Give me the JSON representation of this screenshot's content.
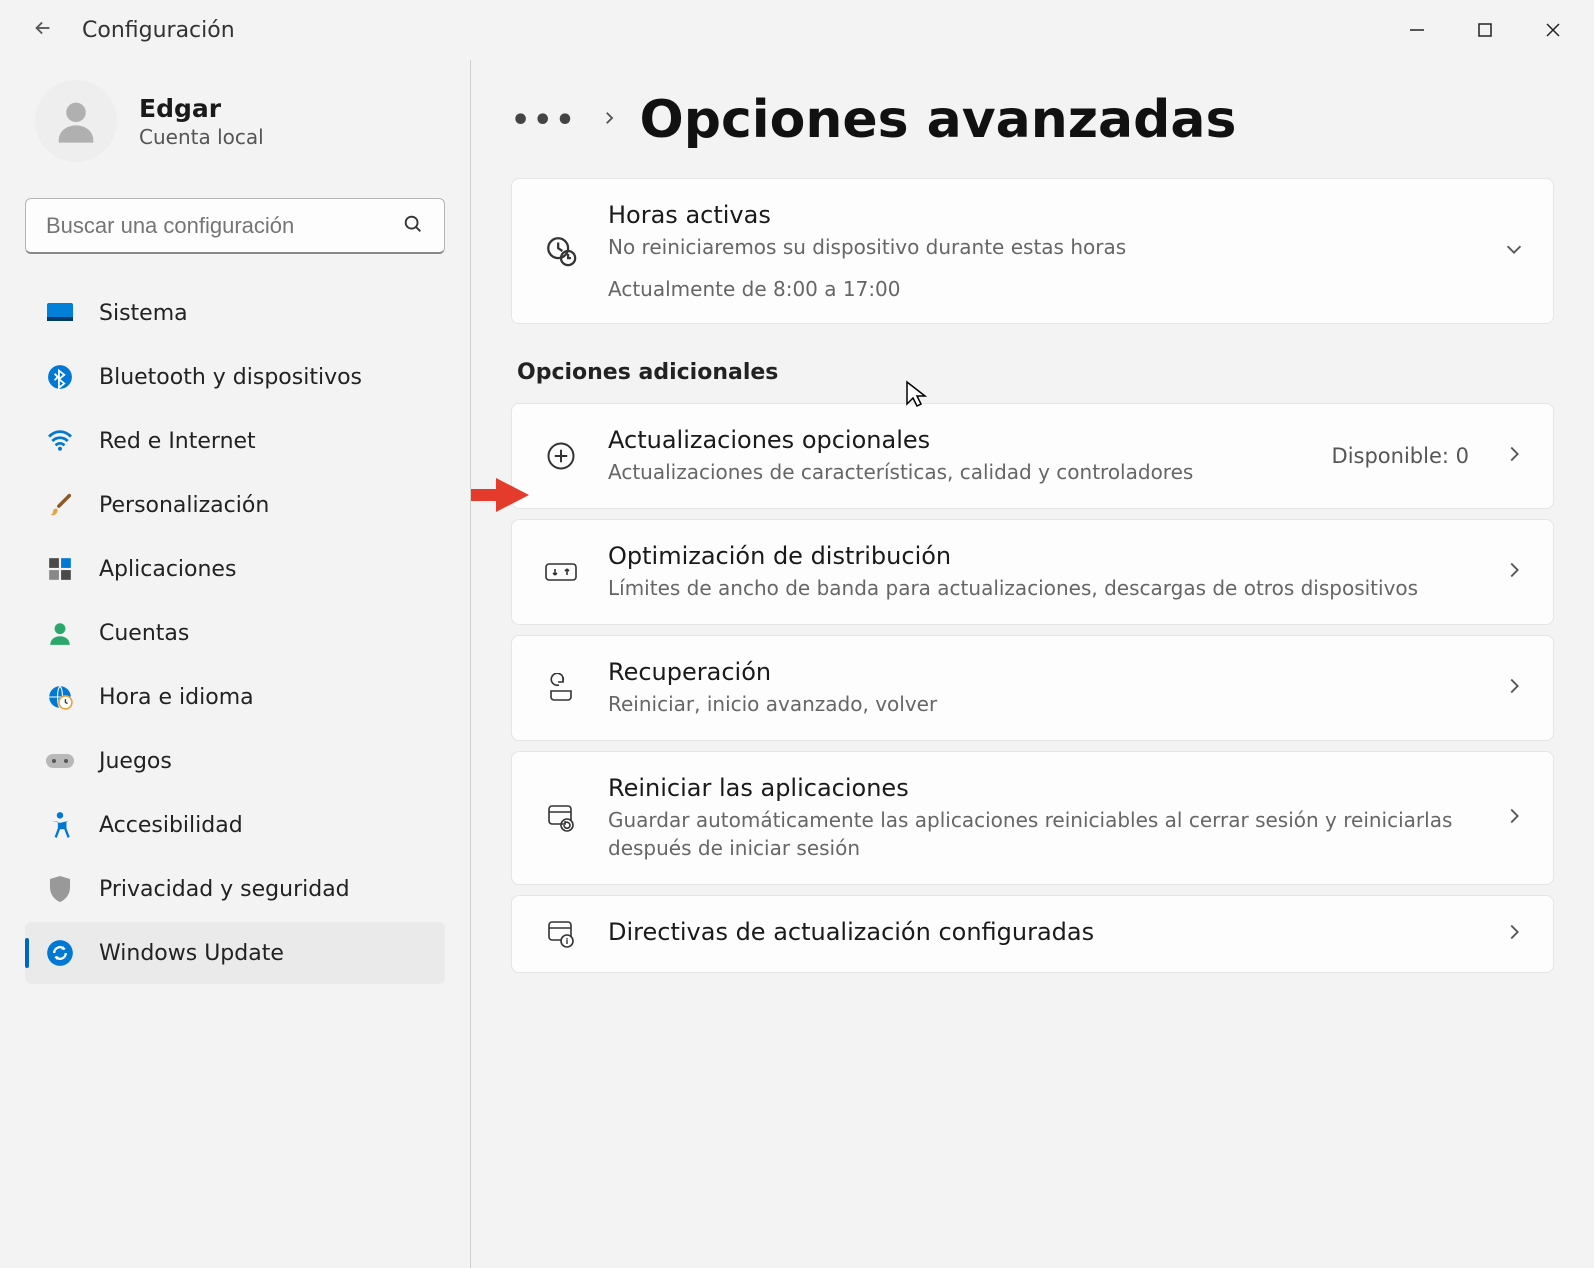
{
  "app": {
    "title": "Configuración"
  },
  "user": {
    "name": "Edgar",
    "account_type": "Cuenta local"
  },
  "search": {
    "placeholder": "Buscar una configuración"
  },
  "sidebar": {
    "items": [
      {
        "label": "Sistema",
        "icon": "monitor"
      },
      {
        "label": "Bluetooth y dispositivos",
        "icon": "bluetooth"
      },
      {
        "label": "Red e Internet",
        "icon": "wifi"
      },
      {
        "label": "Personalización",
        "icon": "brush"
      },
      {
        "label": "Aplicaciones",
        "icon": "apps"
      },
      {
        "label": "Cuentas",
        "icon": "person"
      },
      {
        "label": "Hora e idioma",
        "icon": "globe-clock"
      },
      {
        "label": "Juegos",
        "icon": "gamepad"
      },
      {
        "label": "Accesibilidad",
        "icon": "accessibility"
      },
      {
        "label": "Privacidad y seguridad",
        "icon": "shield"
      },
      {
        "label": "Windows Update",
        "icon": "update",
        "selected": true
      }
    ]
  },
  "breadcrumb": {
    "ellipsis": "…",
    "title": "Opciones avanzadas"
  },
  "active_hours": {
    "title": "Horas activas",
    "subtitle": "No reiniciaremos su dispositivo durante estas horas",
    "detail": "Actualmente de 8:00 a 17:00"
  },
  "section_heading": "Opciones adicionales",
  "cards": [
    {
      "title": "Actualizaciones opcionales",
      "subtitle": "Actualizaciones de características, calidad y controladores",
      "aux": "Disponible: 0"
    },
    {
      "title": "Optimización de distribución",
      "subtitle": "Límites de ancho de banda para actualizaciones, descargas de otros dispositivos"
    },
    {
      "title": "Recuperación",
      "subtitle": "Reiniciar, inicio avanzado, volver"
    },
    {
      "title": "Reiniciar las aplicaciones",
      "subtitle": "Guardar automáticamente las aplicaciones reiniciables al cerrar sesión y reiniciarlas después de iniciar sesión"
    },
    {
      "title": "Directivas de actualización configuradas"
    }
  ]
}
